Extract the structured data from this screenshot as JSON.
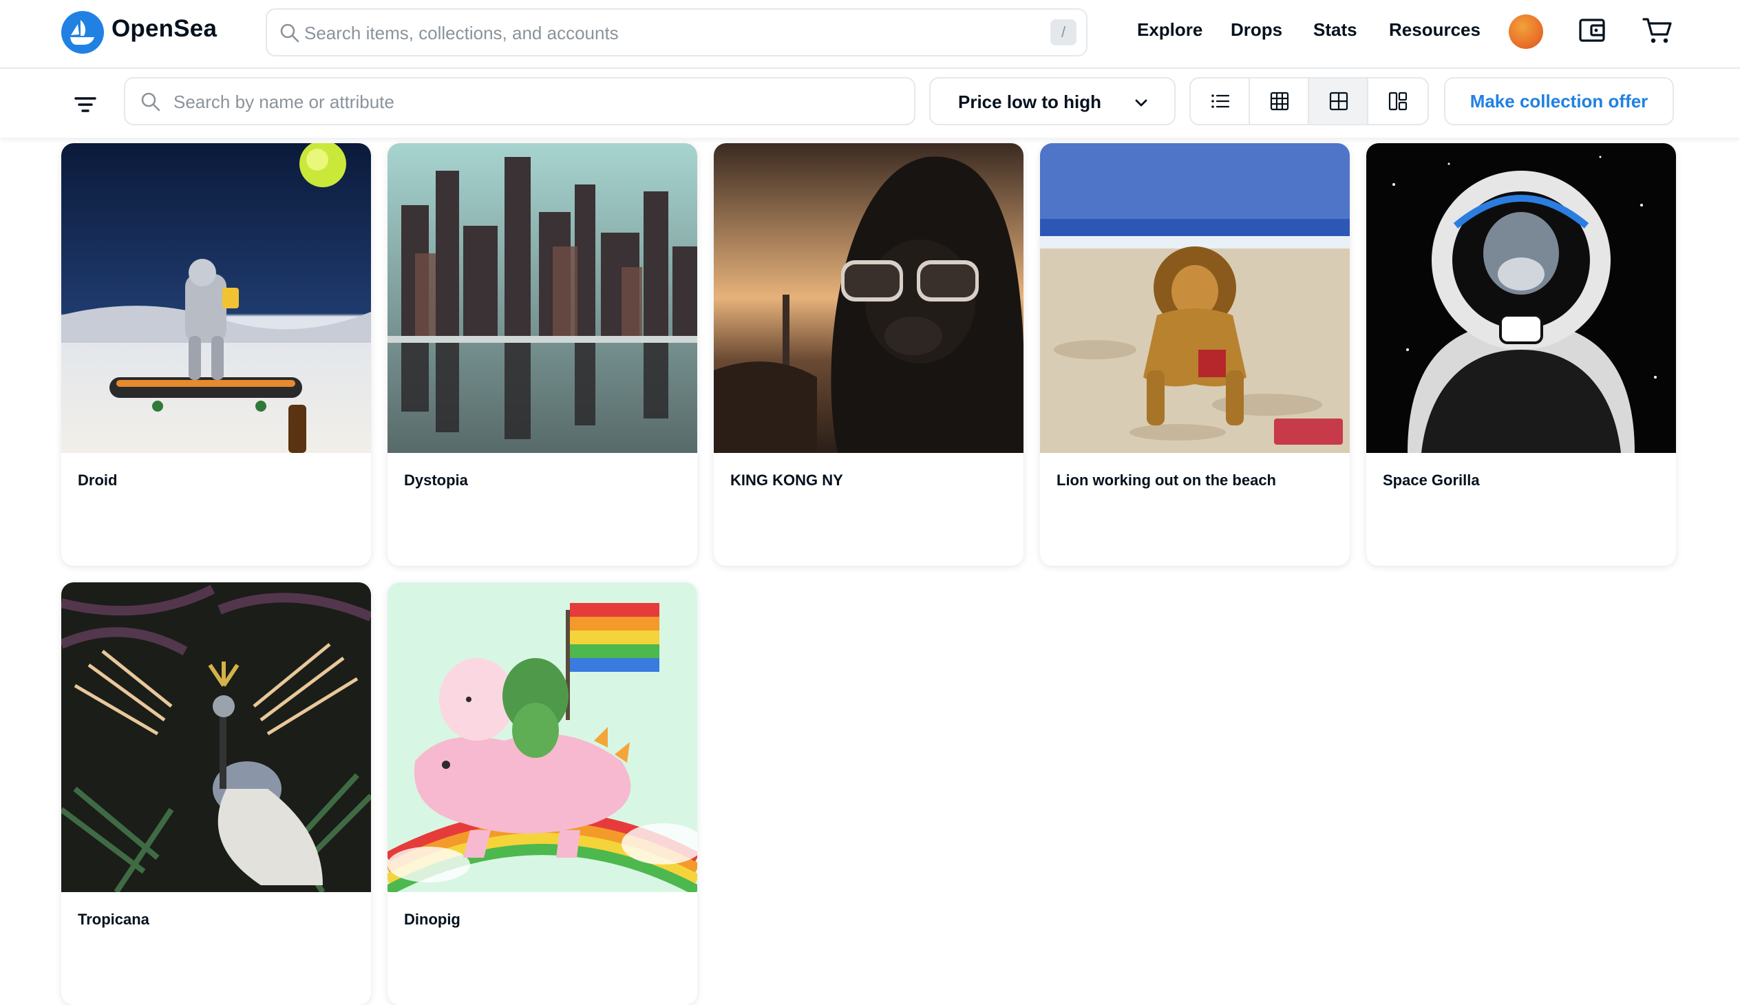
{
  "header": {
    "brand": "OpenSea",
    "search_placeholder": "Search items, collections, and accounts",
    "search_shortcut": "/",
    "nav": [
      "Explore",
      "Drops",
      "Stats",
      "Resources"
    ]
  },
  "toolbar": {
    "search_placeholder": "Search by name or attribute",
    "sort_label": "Price low to high",
    "view_modes": [
      "list-view",
      "grid-small",
      "grid-large",
      "grid-masonry"
    ],
    "active_view": "grid-large",
    "offer_label": "Make collection offer"
  },
  "colors": {
    "accent": "#2081e2",
    "text": "#04111d",
    "border": "#e5e8eb",
    "muted": "#8a939b"
  },
  "items": [
    {
      "name": "Droid"
    },
    {
      "name": "Dystopia"
    },
    {
      "name": "KING KONG NY"
    },
    {
      "name": "Lion working out on the beach"
    },
    {
      "name": "Space Gorilla"
    },
    {
      "name": "Tropicana"
    },
    {
      "name": "Dinopig"
    }
  ]
}
